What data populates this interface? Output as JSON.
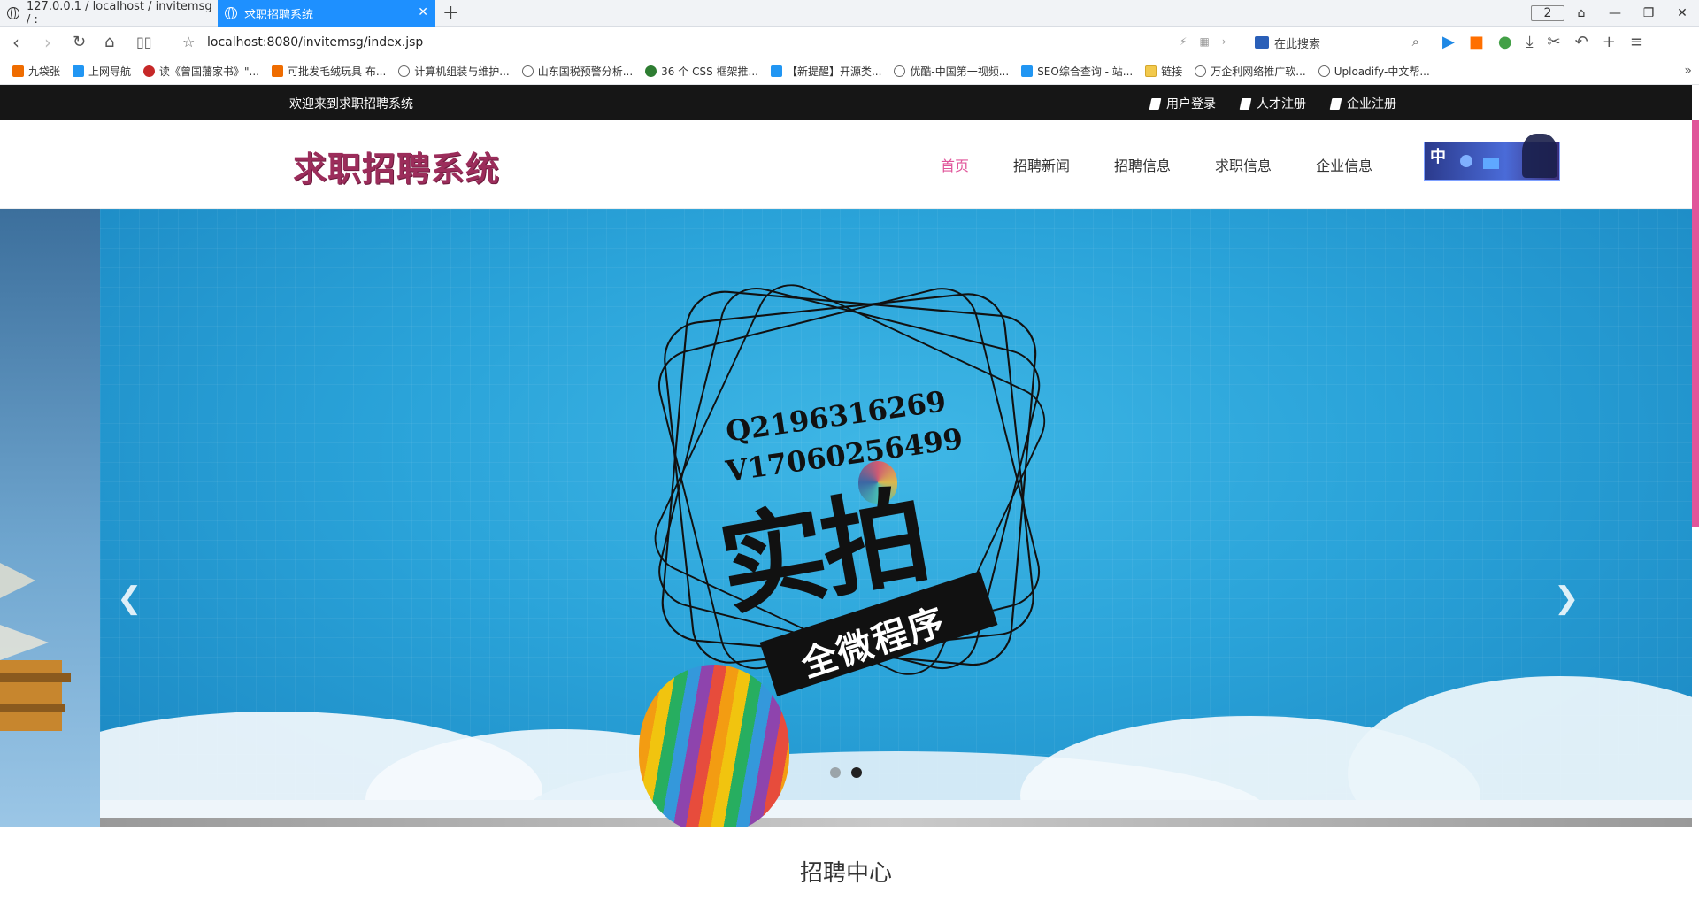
{
  "browser": {
    "tabs": [
      {
        "title": "127.0.0.1 / localhost / invitemsg / :",
        "active": false
      },
      {
        "title": "求职招聘系统",
        "active": true
      }
    ],
    "tab_count": "2",
    "url": "localhost:8080/invitemsg/index.jsp",
    "search_placeholder": "在此搜索",
    "bookmarks": [
      "九袋张",
      "上网导航",
      "读《曾国藩家书》\"...",
      "可批发毛绒玩具 布...",
      "计算机组装与维护...",
      "山东国税预警分析...",
      "36 个 CSS 框架推...",
      "【新提醒】开源类...",
      "优酷-中国第一视频...",
      "SEO综合查询 - 站...",
      "链接",
      "万企利网络推广软...",
      "Uploadify-中文帮..."
    ]
  },
  "site": {
    "welcome": "欢迎来到求职招聘系统",
    "top_links": [
      "用户登录",
      "人才注册",
      "企业注册"
    ],
    "logo": "求职招聘系统",
    "nav": [
      "首页",
      "招聘新闻",
      "招聘信息",
      "求职信息",
      "企业信息"
    ],
    "active_nav_index": 0,
    "ime_char": "中",
    "banner": {
      "line1": "Q2196316269",
      "line2": "V17060256499",
      "big_text": "实拍",
      "ribbon_text": "全微程序",
      "active_slide": 2,
      "slide_count": 2
    },
    "section_title": "招聘中心"
  },
  "colors": {
    "accent": "#e0559a",
    "logo": "#9c2d5b",
    "topbar": "#161616",
    "tab_active": "#1e90ff"
  }
}
